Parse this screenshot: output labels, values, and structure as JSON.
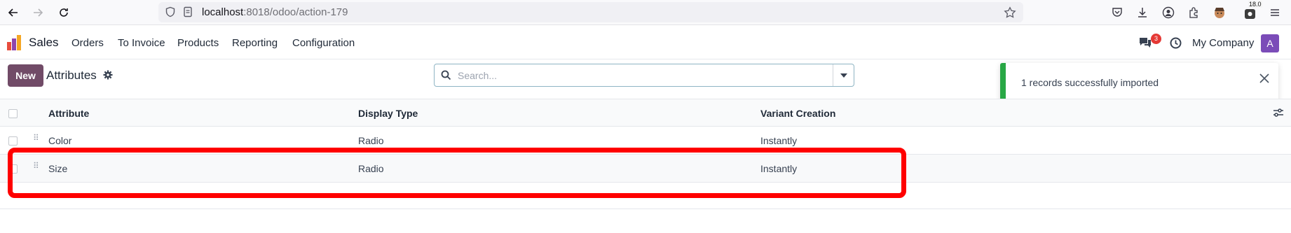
{
  "browser": {
    "url_host": "localhost",
    "url_rest": ":8018/odoo/action-179",
    "ext_badge": "18.0"
  },
  "navbar": {
    "app_name": "Sales",
    "menu": [
      "Orders",
      "To Invoice",
      "Products",
      "Reporting",
      "Configuration"
    ],
    "messages_count": "3",
    "company": "My Company",
    "avatar_initial": "A"
  },
  "control_panel": {
    "new_label": "New",
    "title": "Attributes",
    "search_placeholder": "Search..."
  },
  "table": {
    "columns": [
      "Attribute",
      "Display Type",
      "Variant Creation"
    ],
    "rows": [
      {
        "attribute": "Color",
        "display_type": "Radio",
        "variant_creation": "Instantly"
      },
      {
        "attribute": "Size",
        "display_type": "Radio",
        "variant_creation": "Instantly"
      }
    ]
  },
  "notification": {
    "message": "1 records successfully imported"
  },
  "colors": {
    "brand": "#714b67",
    "highlight": "#ff0000",
    "success": "#28a745"
  }
}
